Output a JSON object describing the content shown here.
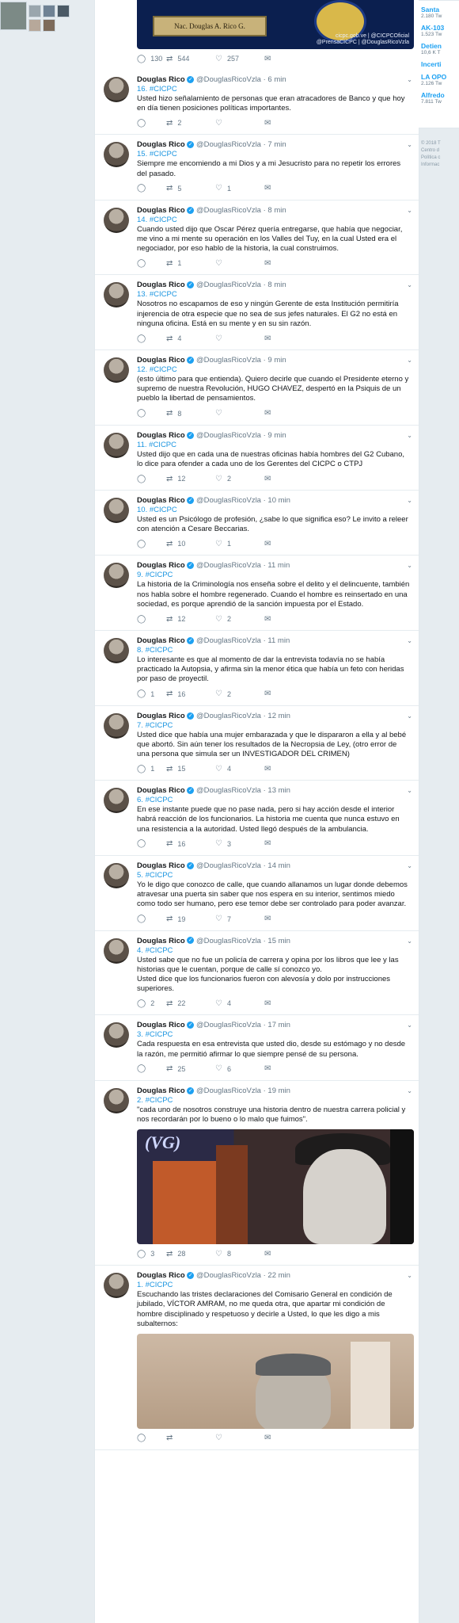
{
  "top_tweet": {
    "plaque_text": "Nac. Douglas A. Rico G.",
    "credits_line1": "cicpc.gob.ve | @CICPCOficial",
    "credits_line2": "@PrensaCICPC | @DouglasRicoVzla",
    "replies": "130",
    "retweets": "544",
    "likes": "257"
  },
  "tweets": [
    {
      "name": "Douglas Rico",
      "handle": "@DouglasRicoVzla",
      "time": "6 min",
      "num": "16.",
      "hashtag": "#CICPC",
      "text": "Usted hizo señalamiento de personas que eran atracadores de Banco y que hoy en día tienen posiciones políticas importantes.",
      "replies": "",
      "retweets": "2",
      "likes": ""
    },
    {
      "name": "Douglas Rico",
      "handle": "@DouglasRicoVzla",
      "time": "7 min",
      "num": "15.",
      "hashtag": "#CICPC",
      "text": "Siempre me encomiendo a mi Dios y a mi Jesucristo para no repetir los errores del pasado.",
      "replies": "",
      "retweets": "5",
      "likes": "1"
    },
    {
      "name": "Douglas Rico",
      "handle": "@DouglasRicoVzla",
      "time": "8 min",
      "num": "14.",
      "hashtag": "#CICPC",
      "text": "Cuando usted dijo que Oscar Pérez  quería entregarse, que había que negociar, me vino a mi mente su operación en los Valles del Tuy, en la cual Usted era el negociador,  por eso hablo de la historia, la cual construimos.",
      "replies": "",
      "retweets": "1",
      "likes": ""
    },
    {
      "name": "Douglas Rico",
      "handle": "@DouglasRicoVzla",
      "time": "8 min",
      "num": "13.",
      "hashtag": "#CICPC",
      "text": "Nosotros no escapamos de eso y ningún Gerente de esta Institución permitiría injerencia de otra especie que no sea de sus jefes naturales.  El G2 no está en ninguna oficina.  Está en su mente y en su sin razón.",
      "replies": "",
      "retweets": "4",
      "likes": ""
    },
    {
      "name": "Douglas Rico",
      "handle": "@DouglasRicoVzla",
      "time": "9 min",
      "num": "12.",
      "hashtag": "#CICPC",
      "text": "(esto último para que entienda).  Quiero decirle que cuando el Presidente eterno y supremo de nuestra Revolución, HUGO CHAVEZ, despertó en la Psiquis de un pueblo la libertad de pensamientos.",
      "replies": "",
      "retweets": "8",
      "likes": ""
    },
    {
      "name": "Douglas Rico",
      "handle": "@DouglasRicoVzla",
      "time": "9 min",
      "num": "11.",
      "hashtag": "#CICPC",
      "text": "Usted dijo que en cada una de nuestras oficinas había hombres del G2 Cubano, lo dice para ofender a cada uno de los Gerentes del CICPC o CTPJ",
      "replies": "",
      "retweets": "12",
      "likes": "2"
    },
    {
      "name": "Douglas Rico",
      "handle": "@DouglasRicoVzla",
      "time": "10 min",
      "num": "10.",
      "hashtag": "#CICPC",
      "text": "Usted es un Psicólogo de profesión, ¿sabe lo que significa eso?  Le invito a releer con atención a Cesare Beccarias.",
      "replies": "",
      "retweets": "10",
      "likes": "1"
    },
    {
      "name": "Douglas Rico",
      "handle": "@DouglasRicoVzla",
      "time": "11 min",
      "num": "9.",
      "hashtag": "#CICPC",
      "text": "La historia de la Criminología nos enseña sobre el delito y el delincuente, también nos habla sobre el hombre regenerado.  Cuando el hombre es reinsertado en una sociedad, es porque aprendió de la sanción impuesta por el Estado.",
      "replies": "",
      "retweets": "12",
      "likes": "2"
    },
    {
      "name": "Douglas Rico",
      "handle": "@DouglasRicoVzla",
      "time": "11 min",
      "num": "8.",
      "hashtag": "#CICPC",
      "text": "Lo interesante es que al momento de dar la entrevista todavía no se había practicado la Autopsia, y afirma sin la menor ética que había un feto con heridas por paso de proyectil.",
      "replies": "1",
      "retweets": "16",
      "likes": "2"
    },
    {
      "name": "Douglas Rico",
      "handle": "@DouglasRicoVzla",
      "time": "12 min",
      "num": "7.",
      "hashtag": "#CICPC",
      "text": "Usted dice que había una mujer embarazada y que le dispararon a ella y al bebé que abortó.  Sin aún tener los resultados de la Necropsia de Ley, (otro error de una persona que simula ser un INVESTIGADOR DEL CRIMEN)",
      "replies": "1",
      "retweets": "15",
      "likes": "4"
    },
    {
      "name": "Douglas Rico",
      "handle": "@DouglasRicoVzla",
      "time": "13 min",
      "num": "6.",
      "hashtag": "#CICPC",
      "text": "En ese instante puede que no pase nada, pero si hay acción desde el interior habrá reacción de los funcionarios.  La historia me cuenta que nunca estuvo en una resistencia a la autoridad. Usted llegó después de la ambulancia.",
      "replies": "",
      "retweets": "16",
      "likes": "3"
    },
    {
      "name": "Douglas Rico",
      "handle": "@DouglasRicoVzla",
      "time": "14 min",
      "num": "5.",
      "hashtag": "#CICPC",
      "text": "Yo le digo que conozco de calle, que cuando allanamos un lugar donde debemos atravesar una puerta sin saber que nos espera en su interior, sentimos miedo como todo ser humano, pero ese temor debe ser controlado para poder avanzar.",
      "replies": "",
      "retweets": "19",
      "likes": "7"
    },
    {
      "name": "Douglas Rico",
      "handle": "@DouglasRicoVzla",
      "time": "15 min",
      "num": "4.",
      "hashtag": "#CICPC",
      "text": "Usted sabe que no fue un policía de carrera y opina por los libros que lee y las historias que le cuentan, porque de calle sí conozco yo.\nUsted dice que los funcionarios fueron con alevosía y dolo por instrucciones superiores.",
      "replies": "2",
      "retweets": "22",
      "likes": "4"
    },
    {
      "name": "Douglas Rico",
      "handle": "@DouglasRicoVzla",
      "time": "17 min",
      "num": "3.",
      "hashtag": "#CICPC",
      "text": "Cada respuesta en esa entrevista que usted dio, desde su estómago y no desde la razón, me permitió afirmar lo que siempre pensé de su persona.",
      "replies": "",
      "retweets": "25",
      "likes": "6"
    },
    {
      "name": "Douglas Rico",
      "handle": "@DouglasRicoVzla",
      "time": "19 min",
      "num": "2.",
      "hashtag": "#CICPC",
      "text": "\"cada uno de nosotros construye una historia dentro de nuestra carrera policial y nos recordarán por lo bueno o lo malo que fuimos\".",
      "replies": "3",
      "retweets": "28",
      "likes": "8",
      "media": "vg",
      "media_logo": "(VG)"
    },
    {
      "name": "Douglas Rico",
      "handle": "@DouglasRicoVzla",
      "time": "22 min",
      "num": "1.",
      "hashtag": "#CICPC",
      "text": "Escuchando las tristes declaraciones del Comisario General en condición de jubilado, VÍCTOR AMRAM, no me queda otra, que apartar mi condición de hombre disciplinado y respetuoso y decirle a Usted, lo que les digo a mis subalternos:",
      "replies": "",
      "retweets": "",
      "likes": "",
      "media": "room"
    }
  ],
  "sidebar": {
    "trends": [
      {
        "title": "Santa",
        "count": "2.180 Tw"
      },
      {
        "title": "AK-103",
        "count": "1.523 Tw"
      },
      {
        "title": "Detien",
        "count": "10,6 K T"
      },
      {
        "title": "Incerti",
        "count": ""
      },
      {
        "title": "LA OPO",
        "count": "2.126 Tw"
      },
      {
        "title": "Alfredo",
        "count": "7.811 Tw"
      }
    ],
    "footer": [
      "© 2018 T",
      "Centro d",
      "Política c",
      "Informac"
    ]
  }
}
